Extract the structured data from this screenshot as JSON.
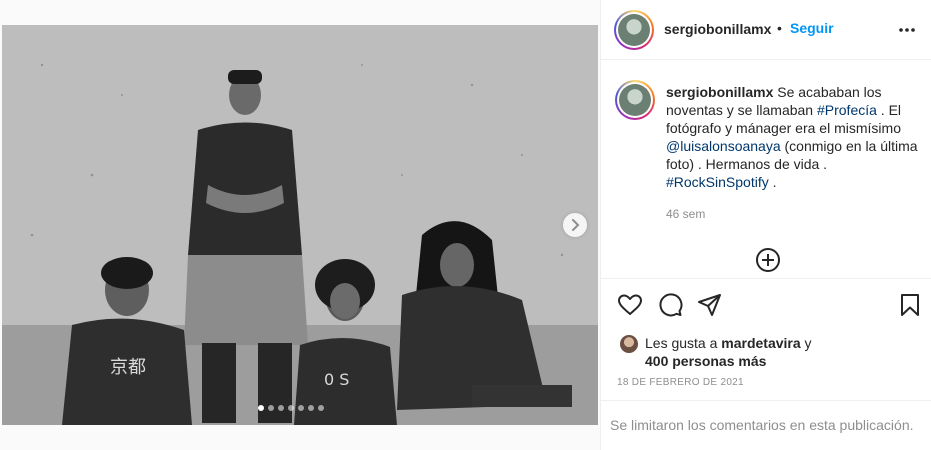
{
  "post": {
    "username": "sergiobonillamx",
    "follow_label": "Seguir",
    "separator": "•",
    "caption": {
      "part1": " Se acababan los noventas y se llamaban ",
      "hashtag1": "#Profecía",
      "part2": " . El fotógrafo y mánager era el mismísimo ",
      "mention": "@luisalonsoanaya",
      "part3": " (conmigo en la última foto) . Hermanos de vida . ",
      "hashtag2": "#RockSinSpotify",
      "part4": " ."
    },
    "time_ago": "46 sem",
    "likes": {
      "prefix": "Les gusta a ",
      "liker": "mardetavira",
      "joiner": " y",
      "others": "400 personas más"
    },
    "date": "18 DE FEBRERO DE 2021",
    "comments_disabled": "Se limitaron los comentarios en esta publicación."
  },
  "carousel": {
    "slides": 7,
    "current": 1
  },
  "icons": {
    "more": "more-horizontal-icon",
    "add_comment": "plus-circle-icon",
    "like": "heart-icon",
    "comment": "comment-icon",
    "share": "paper-plane-icon",
    "save": "bookmark-icon",
    "next": "chevron-right-icon"
  },
  "colors": {
    "link": "#00376b",
    "follow": "#0095f6",
    "muted": "#8e8e8e",
    "text": "#262626"
  }
}
